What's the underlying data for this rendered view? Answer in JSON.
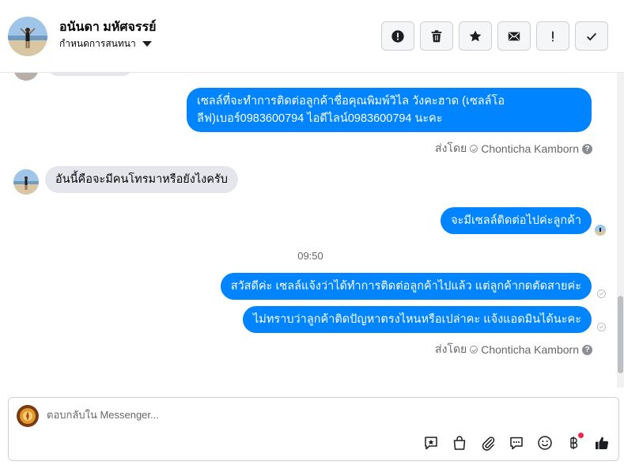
{
  "header": {
    "contact_name": "อนันดา มหัศจรรย์",
    "assign_label": "กำหนดการสนทนา",
    "toolbar": [
      {
        "name": "report-spam-button",
        "icon": "exclamation-circle-icon"
      },
      {
        "name": "delete-button",
        "icon": "trash-icon"
      },
      {
        "name": "star-button",
        "icon": "star-icon"
      },
      {
        "name": "mark-unread-button",
        "icon": "envelope-icon"
      },
      {
        "name": "follow-up-button",
        "icon": "exclamation-icon"
      },
      {
        "name": "mark-done-button",
        "icon": "checkmark-icon"
      }
    ]
  },
  "messages": {
    "msg1_line1": "เซลล์ที่จะทำการติดต่อลูกค้าชื่อคุณพิมพ์วิไล วังคะฮาด (เซลล์โอ",
    "msg1_line2": "ลีฟ)เบอร์0983600794 ไอดีไลน์0983600794 นะคะ",
    "sentby1_prefix": "ส่งโดย",
    "sentby1_name": "Chonticha Kamborn",
    "msg2": "อันนี้คือจะมีคนโทรมาหรือยังไงครับ",
    "msg3": "จะมีเซลล์ติดต่อไปค่ะลูกค้า",
    "timestamp": "09:50",
    "msg4": "สวัสดีค่ะ เซลล์แจ้งว่าได้ทำการติดต่อลูกค้าไปแล้ว แต่ลูกค้ากดตัดสายค่ะ",
    "msg5": "ไม่ทราบว่าลูกค้าติดปัญหาตรงไหนหรือเปล่าคะ แจ้งแอดมินได้นะคะ",
    "sentby2_prefix": "ส่งโดย",
    "sentby2_name": "Chonticha Kamborn"
  },
  "composer": {
    "placeholder": "ตอบกลับใน Messenger...",
    "tools": [
      "saved-reply-icon",
      "shopping-bag-icon",
      "paperclip-icon",
      "chat-bubble-icon",
      "emoji-icon",
      "baht-icon",
      "thumbs-up-icon"
    ]
  },
  "colors": {
    "outgoing_bubble": "#0084ff",
    "incoming_bubble": "#e4e6eb",
    "accent": "#0084ff",
    "notification_dot": "#f02849"
  }
}
